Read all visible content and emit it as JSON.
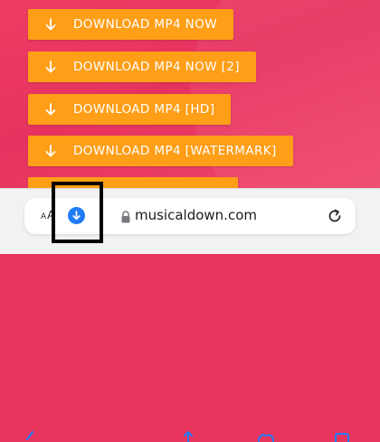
{
  "page": {
    "download_buttons": [
      {
        "label": "DOWNLOAD MP4 NOW"
      },
      {
        "label": "DOWNLOAD MP4 NOW [2]"
      },
      {
        "label": "DOWNLOAD MP4 [HD]"
      },
      {
        "label": "DOWNLOAD MP4 [WATERMARK]"
      }
    ]
  },
  "browser": {
    "text_size_label_small": "A",
    "text_size_label_large": "A",
    "url": "musicaldown.com"
  },
  "colors": {
    "page_background": "#e8365f",
    "button": "#ff9e17",
    "download_badge": "#1f7cf6",
    "highlight_box": "#000000"
  },
  "icons": [
    "download-arrow-icon",
    "download-indicator-icon",
    "lock-icon",
    "reload-icon",
    "back-icon",
    "share-icon",
    "bookmarks-icon",
    "tabs-icon"
  ]
}
